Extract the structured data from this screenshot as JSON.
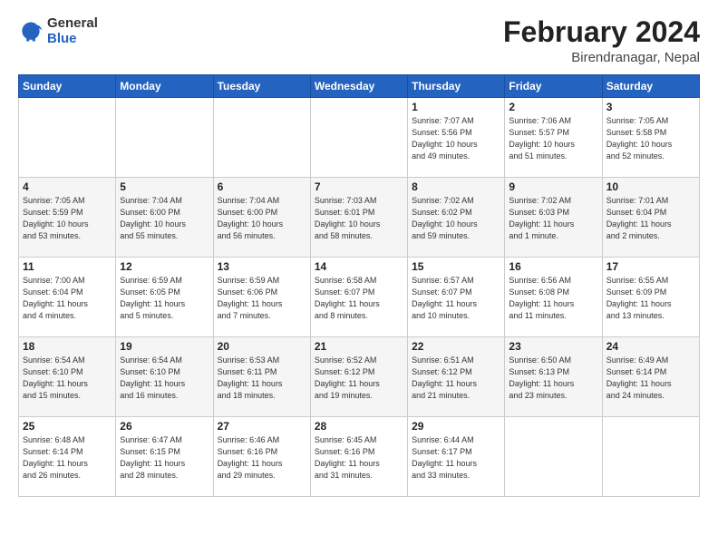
{
  "logo": {
    "general": "General",
    "blue": "Blue"
  },
  "title": "February 2024",
  "subtitle": "Birendranagar, Nepal",
  "headers": [
    "Sunday",
    "Monday",
    "Tuesday",
    "Wednesday",
    "Thursday",
    "Friday",
    "Saturday"
  ],
  "weeks": [
    [
      {
        "day": "",
        "info": ""
      },
      {
        "day": "",
        "info": ""
      },
      {
        "day": "",
        "info": ""
      },
      {
        "day": "",
        "info": ""
      },
      {
        "day": "1",
        "info": "Sunrise: 7:07 AM\nSunset: 5:56 PM\nDaylight: 10 hours\nand 49 minutes."
      },
      {
        "day": "2",
        "info": "Sunrise: 7:06 AM\nSunset: 5:57 PM\nDaylight: 10 hours\nand 51 minutes."
      },
      {
        "day": "3",
        "info": "Sunrise: 7:05 AM\nSunset: 5:58 PM\nDaylight: 10 hours\nand 52 minutes."
      }
    ],
    [
      {
        "day": "4",
        "info": "Sunrise: 7:05 AM\nSunset: 5:59 PM\nDaylight: 10 hours\nand 53 minutes."
      },
      {
        "day": "5",
        "info": "Sunrise: 7:04 AM\nSunset: 6:00 PM\nDaylight: 10 hours\nand 55 minutes."
      },
      {
        "day": "6",
        "info": "Sunrise: 7:04 AM\nSunset: 6:00 PM\nDaylight: 10 hours\nand 56 minutes."
      },
      {
        "day": "7",
        "info": "Sunrise: 7:03 AM\nSunset: 6:01 PM\nDaylight: 10 hours\nand 58 minutes."
      },
      {
        "day": "8",
        "info": "Sunrise: 7:02 AM\nSunset: 6:02 PM\nDaylight: 10 hours\nand 59 minutes."
      },
      {
        "day": "9",
        "info": "Sunrise: 7:02 AM\nSunset: 6:03 PM\nDaylight: 11 hours\nand 1 minute."
      },
      {
        "day": "10",
        "info": "Sunrise: 7:01 AM\nSunset: 6:04 PM\nDaylight: 11 hours\nand 2 minutes."
      }
    ],
    [
      {
        "day": "11",
        "info": "Sunrise: 7:00 AM\nSunset: 6:04 PM\nDaylight: 11 hours\nand 4 minutes."
      },
      {
        "day": "12",
        "info": "Sunrise: 6:59 AM\nSunset: 6:05 PM\nDaylight: 11 hours\nand 5 minutes."
      },
      {
        "day": "13",
        "info": "Sunrise: 6:59 AM\nSunset: 6:06 PM\nDaylight: 11 hours\nand 7 minutes."
      },
      {
        "day": "14",
        "info": "Sunrise: 6:58 AM\nSunset: 6:07 PM\nDaylight: 11 hours\nand 8 minutes."
      },
      {
        "day": "15",
        "info": "Sunrise: 6:57 AM\nSunset: 6:07 PM\nDaylight: 11 hours\nand 10 minutes."
      },
      {
        "day": "16",
        "info": "Sunrise: 6:56 AM\nSunset: 6:08 PM\nDaylight: 11 hours\nand 11 minutes."
      },
      {
        "day": "17",
        "info": "Sunrise: 6:55 AM\nSunset: 6:09 PM\nDaylight: 11 hours\nand 13 minutes."
      }
    ],
    [
      {
        "day": "18",
        "info": "Sunrise: 6:54 AM\nSunset: 6:10 PM\nDaylight: 11 hours\nand 15 minutes."
      },
      {
        "day": "19",
        "info": "Sunrise: 6:54 AM\nSunset: 6:10 PM\nDaylight: 11 hours\nand 16 minutes."
      },
      {
        "day": "20",
        "info": "Sunrise: 6:53 AM\nSunset: 6:11 PM\nDaylight: 11 hours\nand 18 minutes."
      },
      {
        "day": "21",
        "info": "Sunrise: 6:52 AM\nSunset: 6:12 PM\nDaylight: 11 hours\nand 19 minutes."
      },
      {
        "day": "22",
        "info": "Sunrise: 6:51 AM\nSunset: 6:12 PM\nDaylight: 11 hours\nand 21 minutes."
      },
      {
        "day": "23",
        "info": "Sunrise: 6:50 AM\nSunset: 6:13 PM\nDaylight: 11 hours\nand 23 minutes."
      },
      {
        "day": "24",
        "info": "Sunrise: 6:49 AM\nSunset: 6:14 PM\nDaylight: 11 hours\nand 24 minutes."
      }
    ],
    [
      {
        "day": "25",
        "info": "Sunrise: 6:48 AM\nSunset: 6:14 PM\nDaylight: 11 hours\nand 26 minutes."
      },
      {
        "day": "26",
        "info": "Sunrise: 6:47 AM\nSunset: 6:15 PM\nDaylight: 11 hours\nand 28 minutes."
      },
      {
        "day": "27",
        "info": "Sunrise: 6:46 AM\nSunset: 6:16 PM\nDaylight: 11 hours\nand 29 minutes."
      },
      {
        "day": "28",
        "info": "Sunrise: 6:45 AM\nSunset: 6:16 PM\nDaylight: 11 hours\nand 31 minutes."
      },
      {
        "day": "29",
        "info": "Sunrise: 6:44 AM\nSunset: 6:17 PM\nDaylight: 11 hours\nand 33 minutes."
      },
      {
        "day": "",
        "info": ""
      },
      {
        "day": "",
        "info": ""
      }
    ]
  ]
}
